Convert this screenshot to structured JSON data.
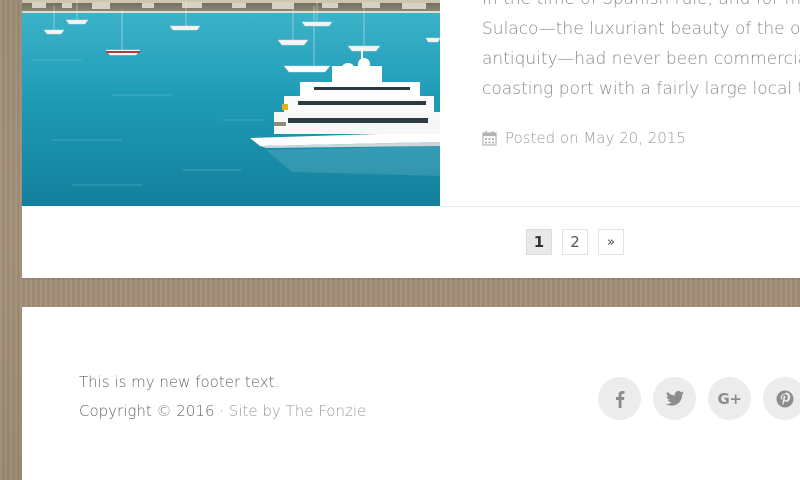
{
  "post": {
    "excerpt_lines": [
      "In the time of Spanish rule, and for ma",
      "Sulaco—the luxuriant beauty of the ora",
      "antiquity—had never been commercial",
      "coasting port with a fairly large local tr"
    ],
    "posted_on": "Posted on May 20, 2015",
    "image_alt": "Yacht in harbor"
  },
  "pagination": {
    "pages": [
      "1",
      "2"
    ],
    "current": "1",
    "next_label": "»"
  },
  "footer": {
    "text": "This is my new footer text.",
    "copyright": "Copyright © 2016 · ",
    "credit_link": "Site by The Fonzie"
  },
  "social": {
    "icons": [
      "facebook-icon",
      "twitter-icon",
      "google-plus-icon",
      "pinterest-icon"
    ],
    "gplus_glyph": "G+"
  },
  "colors": {
    "background": "#a08e78",
    "card": "#ffffff",
    "text_muted": "#8a8a8a",
    "social_bg": "#ececec",
    "social_icon": "#8d8d8d",
    "sea": "#1e9ab5"
  }
}
